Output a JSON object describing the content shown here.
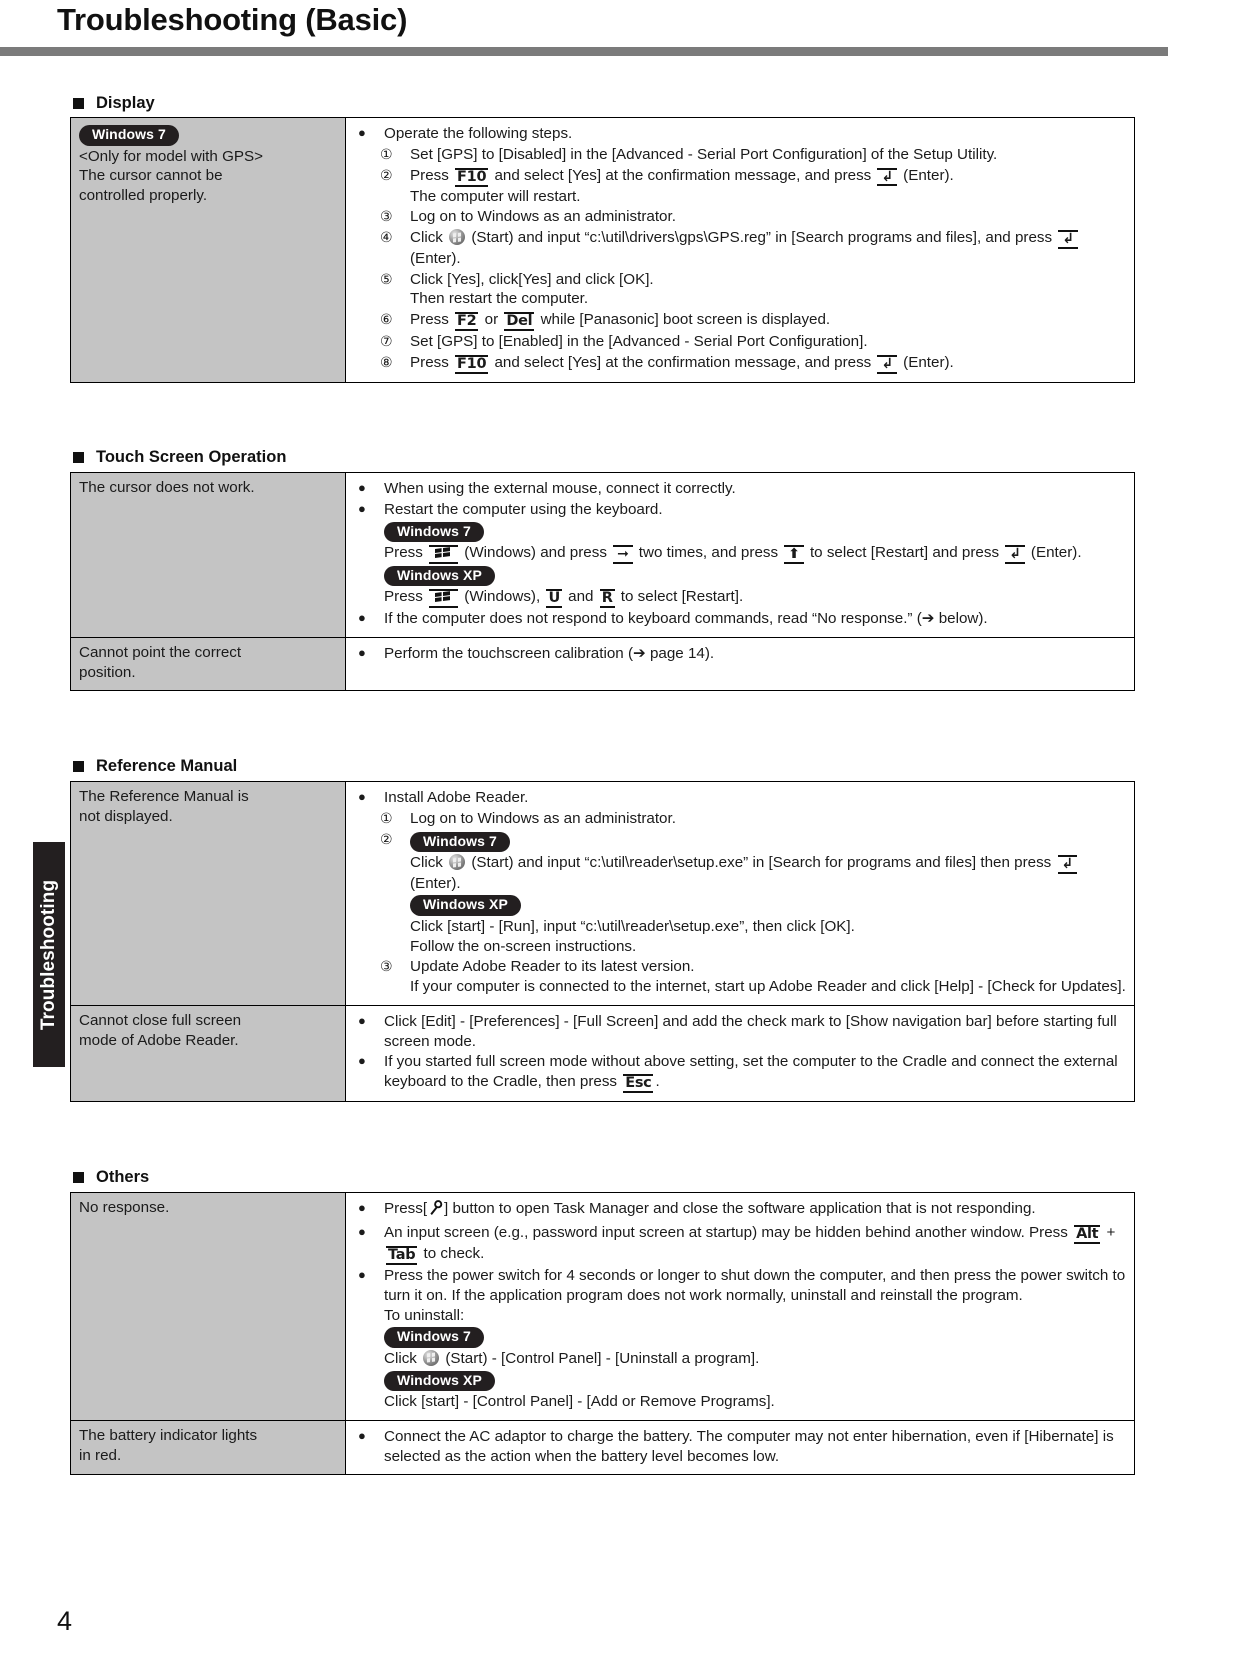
{
  "page": {
    "title": "Troubleshooting (Basic)",
    "number": "4",
    "side_tab": "Troubleshooting"
  },
  "badges": {
    "win7": "Windows 7",
    "winxp": "Windows XP"
  },
  "sections": [
    {
      "id": "display",
      "heading": "Display",
      "rows": [
        {
          "question_badge": "Windows 7",
          "question_lines": [
            "<Only for model with GPS>",
            "The cursor cannot be",
            "controlled properly."
          ],
          "answer": {
            "lead": "Operate the following steps.",
            "steps": [
              {
                "num": "①",
                "text": "Set [GPS] to [Disabled] in the [Advanced - Serial Port Configuration] of the Setup Utility."
              },
              {
                "num": "②",
                "text_a": "Press ",
                "key": "F10",
                "text_b": " and select [Yes] at the confirmation message, and press ",
                "key2": "enter",
                "text_c": " (Enter).",
                "extra": "The computer will restart."
              },
              {
                "num": "③",
                "text": "Log on to Windows as an administrator."
              },
              {
                "num": "④",
                "text_a": "Click ",
                "orb": true,
                "text_b": " (Start) and input “c:\\util\\drivers\\gps\\GPS.reg” in [Search programs and files], and press ",
                "key2": "enter",
                "text_c": " (Enter)."
              },
              {
                "num": "⑤",
                "text": "Click [Yes], click[Yes] and click [OK].",
                "extra": "Then restart the computer."
              },
              {
                "num": "⑥",
                "text_a": "Press ",
                "key": "F2",
                "text_b": " or ",
                "key3": "Del",
                "text_c": " while [Panasonic] boot screen is displayed."
              },
              {
                "num": "⑦",
                "text": "Set [GPS] to [Enabled] in the [Advanced - Serial Port Configuration]."
              },
              {
                "num": "⑧",
                "text_a": "Press ",
                "key": "F10",
                "text_b": " and select [Yes] at the confirmation message, and press ",
                "key2": "enter",
                "text_c": " (Enter)."
              }
            ]
          }
        }
      ]
    },
    {
      "id": "touch-screen-operation",
      "heading": "Touch Screen Operation",
      "rows": [
        {
          "question_lines": [
            "The cursor does not work."
          ],
          "bullets": [
            "When using the external mouse, connect it correctly.",
            "Restart the computer using the keyboard."
          ],
          "win7_line_a": "Press ",
          "win7_line_b": " (Windows) and press ",
          "win7_line_c": " two times, and press ",
          "win7_line_d": "  to select [Restart] and press ",
          "win7_line_e": "  (Enter).",
          "winxp_line_a": "Press ",
          "winxp_line_b": " (Windows), ",
          "winxp_key_u": "U",
          "winxp_line_c": " and ",
          "winxp_key_r": "R",
          "winxp_line_d": "  to select [Restart].",
          "last_bullet": "If the computer does not respond to keyboard commands, read “No response.” (➔ below)."
        },
        {
          "question_lines": [
            "Cannot point the correct",
            "position."
          ],
          "bullets": [
            "Perform the touchscreen calibration (➔ page 14)."
          ]
        }
      ]
    },
    {
      "id": "reference-manual",
      "heading": "Reference Manual",
      "rows": [
        {
          "question_lines": [
            "The Reference Manual is",
            "not displayed."
          ],
          "lead": "Install Adobe Reader.",
          "step1_num": "①",
          "step1": "Log on to Windows as an administrator.",
          "step2_num": "②",
          "win7_click_a": "Click ",
          "win7_click_b": " (Start) and input “c:\\util\\reader\\setup.exe” in [Search for programs and files] then press ",
          "win7_click_c": " (Enter).",
          "winxp_click": "Click [start] - [Run], input “c:\\util\\reader\\setup.exe”, then click [OK].",
          "follow": "Follow the on-screen instructions.",
          "step3_num": "③",
          "step3": "Update Adobe Reader to its latest version.",
          "step3_extra": "If your computer is connected to the internet, start up Adobe Reader and click [Help] - [Check for Updates]."
        },
        {
          "question_lines": [
            "Cannot close full screen",
            "mode of Adobe Reader."
          ],
          "bullet1": "Click [Edit] - [Preferences] - [Full Screen] and add the check mark to [Show navigation bar] before starting full screen mode.",
          "bullet2_a": "If you started full screen mode without above setting, set the computer to the Cradle and connect the external keyboard to the Cradle, then press ",
          "bullet2_key": "Esc",
          "bullet2_b": "."
        }
      ]
    },
    {
      "id": "others",
      "heading": "Others",
      "rows": [
        {
          "question_lines": [
            "No response."
          ],
          "bullet1_a": "Press[",
          "bullet1_b": "] button to open Task Manager and close the software application that is not responding.",
          "bullet2_a": "An input screen (e.g., password input screen at startup) may be hidden behind another window. Press ",
          "bullet2_key1": "Alt",
          "bullet2_plus": " + ",
          "bullet2_key2": "Tab",
          "bullet2_b": " to check.",
          "bullet3": "Press the power switch for 4 seconds or longer to shut down the computer, and then press the power switch to turn it on. If the application program does not work normally, uninstall and reinstall the program.",
          "to_uninstall": "To uninstall:",
          "win7_click_a": "Click ",
          "win7_click_b": " (Start) - [Control Panel] - [Uninstall a program].",
          "winxp_click": "Click [start] - [Control Panel] - [Add or Remove Programs]."
        },
        {
          "question_lines": [
            "The battery indicator lights",
            "in red."
          ],
          "bullets": [
            "Connect the AC adaptor to charge the battery. The computer may not enter hibernation, even if [Hibernate] is selected as the action when the battery level becomes low."
          ]
        }
      ]
    }
  ]
}
